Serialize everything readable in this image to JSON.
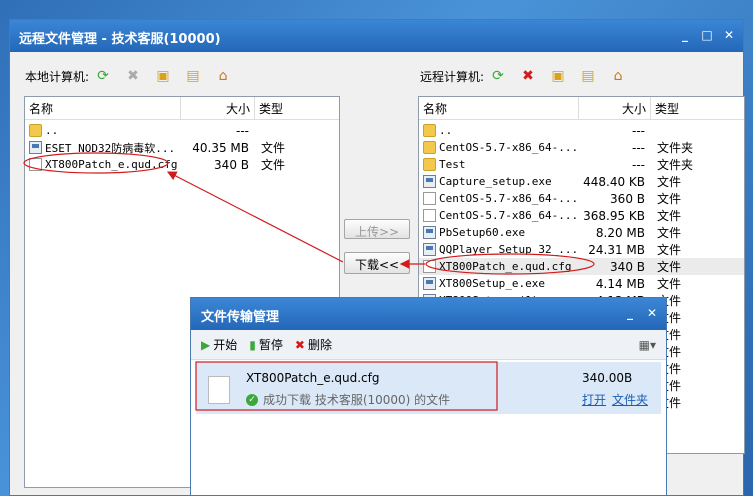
{
  "window": {
    "title": "远程文件管理 - 技术客服(10000)",
    "controls": [
      "_",
      "□",
      "✕"
    ]
  },
  "local": {
    "label": "本地计算机:",
    "columns": [
      "名称",
      "大小",
      "类型"
    ],
    "rows": [
      {
        "name": "..",
        "size": "---",
        "type": "",
        "icon": "folder"
      },
      {
        "name": "ESET NOD32防病毒软...",
        "size": "40.35 MB",
        "type": "文件",
        "icon": "exe"
      },
      {
        "name": "XT800Patch_e.qud.cfg",
        "size": "340 B",
        "type": "文件",
        "icon": "file"
      }
    ]
  },
  "remote": {
    "label": "远程计算机:",
    "columns": [
      "名称",
      "大小",
      "类型"
    ],
    "rows": [
      {
        "name": "..",
        "size": "---",
        "type": "",
        "icon": "folder"
      },
      {
        "name": "CentOS-5.7-x86_64-...",
        "size": "---",
        "type": "文件夹",
        "icon": "folder"
      },
      {
        "name": "Test",
        "size": "---",
        "type": "文件夹",
        "icon": "folder"
      },
      {
        "name": "Capture_setup.exe",
        "size": "448.40 KB",
        "type": "文件",
        "icon": "exe"
      },
      {
        "name": "CentOS-5.7-x86_64-...",
        "size": "360 B",
        "type": "文件",
        "icon": "file"
      },
      {
        "name": "CentOS-5.7-x86_64-...",
        "size": "368.95 KB",
        "type": "文件",
        "icon": "file"
      },
      {
        "name": "PbSetup60.exe",
        "size": "8.20 MB",
        "type": "文件",
        "icon": "exe"
      },
      {
        "name": "QQPlayer Setup 32_...",
        "size": "24.31 MB",
        "type": "文件",
        "icon": "exe"
      },
      {
        "name": "XT800Patch_e.qud.cfg",
        "size": "340 B",
        "type": "文件",
        "icon": "file"
      },
      {
        "name": "XT800Setup_e.exe",
        "size": "4.14 MB",
        "type": "文件",
        "icon": "exe"
      },
      {
        "name": "XT800Setup_e(1).exe",
        "size": "4.13 MB",
        "type": "文件",
        "icon": "exe"
      },
      {
        "name": "",
        "size": "",
        "type": "文件",
        "icon": ""
      },
      {
        "name": "",
        "size": "",
        "type": "文件",
        "icon": ""
      },
      {
        "name": "",
        "size": "",
        "type": "文件",
        "icon": ""
      },
      {
        "name": "",
        "size": "",
        "type": "文件",
        "icon": ""
      },
      {
        "name": "",
        "size": "",
        "type": "文件",
        "icon": ""
      },
      {
        "name": "",
        "size": "",
        "type": "文件",
        "icon": ""
      }
    ]
  },
  "buttons": {
    "upload": "上传>>",
    "download": "下载<<"
  },
  "dialog": {
    "title": "文件传输管理",
    "start": "开始",
    "pause": "暂停",
    "delete": "删除",
    "transfer": {
      "filename": "XT800Patch_e.qud.cfg",
      "status": "成功下载  技术客服(10000) 的文件",
      "size": "340.00B",
      "open": "打开",
      "open_folder": "文件夹"
    }
  },
  "colors": {
    "accent": "#2a6fc6",
    "annotation": "#d21b1b",
    "success": "#3aa83a"
  }
}
